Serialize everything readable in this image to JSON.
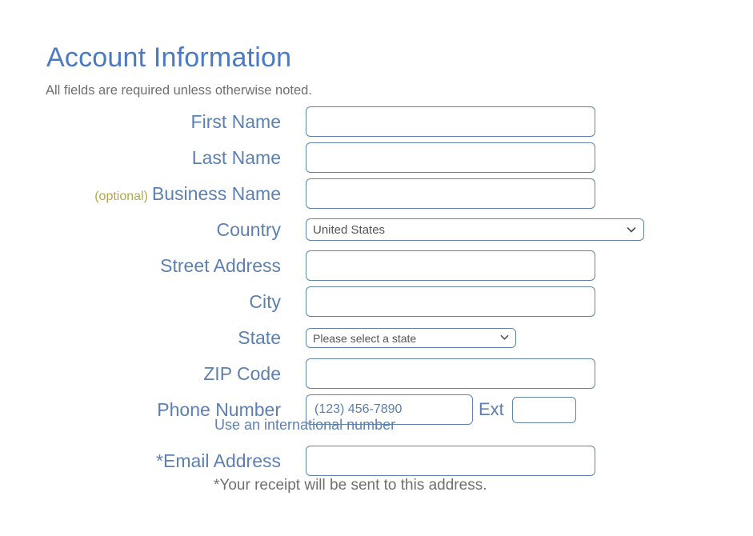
{
  "header": {
    "title": "Account Information",
    "subtitle": "All fields are required unless otherwise noted."
  },
  "form": {
    "fields": [
      {
        "label": "First Name",
        "optional_tag": "",
        "control": "text",
        "value": "",
        "placeholder": ""
      },
      {
        "label": "Last Name",
        "optional_tag": "",
        "control": "text",
        "value": "",
        "placeholder": ""
      },
      {
        "label": "Business Name",
        "optional_tag": "(optional)",
        "control": "text",
        "value": "",
        "placeholder": ""
      },
      {
        "label": "Country",
        "optional_tag": "",
        "control": "select",
        "value": "United States"
      },
      {
        "label": "Street Address",
        "optional_tag": "",
        "control": "text",
        "value": "",
        "placeholder": ""
      },
      {
        "label": "City",
        "optional_tag": "",
        "control": "text",
        "value": "",
        "placeholder": ""
      },
      {
        "label": "State",
        "optional_tag": "",
        "control": "select",
        "value": "Please select a state"
      },
      {
        "label": "ZIP Code",
        "optional_tag": "",
        "control": "text",
        "value": "",
        "placeholder": ""
      },
      {
        "label": "Phone Number",
        "optional_tag": "",
        "control": "phone",
        "value": "",
        "placeholder": "(123) 456-7890"
      },
      {
        "label": "*Email Address",
        "optional_tag": "",
        "control": "text",
        "value": "",
        "placeholder": ""
      }
    ],
    "country_label": "Country",
    "country_value": "United States",
    "state_label": "State",
    "state_value": "Please select a state",
    "first_name_label": "First Name",
    "last_name_label": "Last Name",
    "business_name_label": "Business Name",
    "business_name_optional": "(optional)",
    "street_address_label": "Street Address",
    "city_label": "City",
    "zip_code_label": "ZIP Code",
    "phone_number_label": "Phone Number",
    "phone_placeholder": "(123) 456-7890",
    "ext_label": "Ext",
    "ext_value": "",
    "email_label": "*Email Address",
    "international_link": "Use an international number",
    "email_footnote": "*Your receipt will be sent to this address."
  },
  "icons": {
    "chevron_down": "chevron-down-icon"
  },
  "colors": {
    "title_blue": "#4a7ac4",
    "label_blue": "#5d80b0",
    "optional_gold": "#b3a84e",
    "border_blue": "#5f85a8",
    "muted_gray": "#6f6f6f",
    "background": "#ffffff"
  }
}
